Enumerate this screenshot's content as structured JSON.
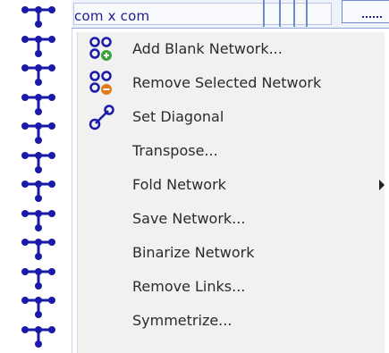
{
  "header": {
    "column_label": "com x com"
  },
  "menu": {
    "items": [
      {
        "label": "Add Blank Network...",
        "icon": "add-network-icon"
      },
      {
        "label": "Remove Selected Network",
        "icon": "remove-network-icon"
      },
      {
        "label": "Set Diagonal",
        "icon": "set-diagonal-icon"
      },
      {
        "label": "Transpose..."
      },
      {
        "label": "Fold Network",
        "has_submenu": true
      },
      {
        "label": "Save Network..."
      },
      {
        "label": "Binarize Network"
      },
      {
        "label": "Remove Links..."
      },
      {
        "label": "Symmetrize..."
      }
    ]
  },
  "colors": {
    "icon_blue": "#1a1aa8",
    "add_green": "#3aa43a",
    "remove_orange": "#e07a1a",
    "menu_bg": "#f1f1f1",
    "header_line": "#6f8ccb"
  },
  "left_strip": {
    "icon": "network-tree-icon",
    "count": 12
  }
}
